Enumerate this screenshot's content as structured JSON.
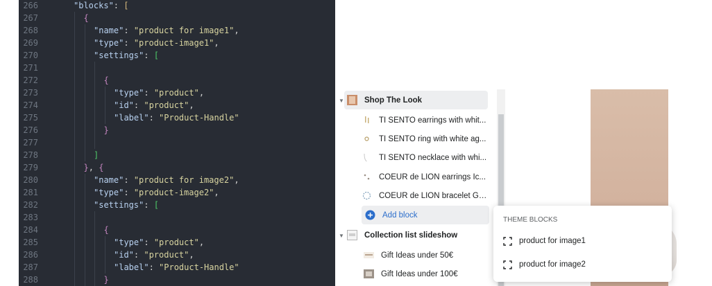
{
  "editor": {
    "lines": [
      {
        "n": "266",
        "indent": 1,
        "t": [
          [
            "key",
            "\"blocks\""
          ],
          [
            "pun",
            ": "
          ],
          [
            "p1",
            "["
          ]
        ]
      },
      {
        "n": "267",
        "indent": 2,
        "t": [
          [
            "p2",
            "{"
          ]
        ]
      },
      {
        "n": "268",
        "indent": 3,
        "t": [
          [
            "key",
            "\"name\""
          ],
          [
            "pun",
            ": "
          ],
          [
            "str",
            "\"product for image1\""
          ],
          [
            "pun",
            ","
          ]
        ]
      },
      {
        "n": "269",
        "indent": 3,
        "t": [
          [
            "key",
            "\"type\""
          ],
          [
            "pun",
            ": "
          ],
          [
            "str",
            "\"product-image1\""
          ],
          [
            "pun",
            ","
          ]
        ]
      },
      {
        "n": "270",
        "indent": 3,
        "t": [
          [
            "key",
            "\"settings\""
          ],
          [
            "pun",
            ": "
          ],
          [
            "p4",
            "["
          ]
        ]
      },
      {
        "n": "271",
        "indent": 4,
        "t": []
      },
      {
        "n": "272",
        "indent": 4,
        "t": [
          [
            "p2",
            "{"
          ]
        ]
      },
      {
        "n": "273",
        "indent": 5,
        "t": [
          [
            "key",
            "\"type\""
          ],
          [
            "pun",
            ": "
          ],
          [
            "str",
            "\"product\""
          ],
          [
            "pun",
            ","
          ]
        ]
      },
      {
        "n": "274",
        "indent": 5,
        "t": [
          [
            "key",
            "\"id\""
          ],
          [
            "pun",
            ": "
          ],
          [
            "str",
            "\"product\""
          ],
          [
            "pun",
            ","
          ]
        ]
      },
      {
        "n": "275",
        "indent": 5,
        "t": [
          [
            "key",
            "\"label\""
          ],
          [
            "pun",
            ": "
          ],
          [
            "str",
            "\"Product-Handle\""
          ]
        ]
      },
      {
        "n": "276",
        "indent": 4,
        "t": [
          [
            "p2",
            "}"
          ]
        ]
      },
      {
        "n": "277",
        "indent": 4,
        "t": []
      },
      {
        "n": "278",
        "indent": 3,
        "t": [
          [
            "p4",
            "]"
          ]
        ]
      },
      {
        "n": "279",
        "indent": 2,
        "t": [
          [
            "p2",
            "}"
          ],
          [
            "pun",
            ", "
          ],
          [
            "p2",
            "{"
          ]
        ]
      },
      {
        "n": "280",
        "indent": 3,
        "t": [
          [
            "key",
            "\"name\""
          ],
          [
            "pun",
            ": "
          ],
          [
            "str",
            "\"product for image2\""
          ],
          [
            "pun",
            ","
          ]
        ]
      },
      {
        "n": "281",
        "indent": 3,
        "t": [
          [
            "key",
            "\"type\""
          ],
          [
            "pun",
            ": "
          ],
          [
            "str",
            "\"product-image2\""
          ],
          [
            "pun",
            ","
          ]
        ]
      },
      {
        "n": "282",
        "indent": 3,
        "t": [
          [
            "key",
            "\"settings\""
          ],
          [
            "pun",
            ": "
          ],
          [
            "p4",
            "["
          ]
        ]
      },
      {
        "n": "283",
        "indent": 4,
        "t": []
      },
      {
        "n": "284",
        "indent": 4,
        "t": [
          [
            "p2",
            "{"
          ]
        ]
      },
      {
        "n": "285",
        "indent": 5,
        "t": [
          [
            "key",
            "\"type\""
          ],
          [
            "pun",
            ": "
          ],
          [
            "str",
            "\"product\""
          ],
          [
            "pun",
            ","
          ]
        ]
      },
      {
        "n": "286",
        "indent": 5,
        "t": [
          [
            "key",
            "\"id\""
          ],
          [
            "pun",
            ": "
          ],
          [
            "str",
            "\"product\""
          ],
          [
            "pun",
            ","
          ]
        ]
      },
      {
        "n": "287",
        "indent": 5,
        "t": [
          [
            "key",
            "\"label\""
          ],
          [
            "pun",
            ": "
          ],
          [
            "str",
            "\"Product-Handle\""
          ]
        ]
      },
      {
        "n": "288",
        "indent": 4,
        "t": [
          [
            "p2",
            "}"
          ]
        ]
      }
    ]
  },
  "sidebar": {
    "shop_the_look": {
      "label": "Shop The Look",
      "blocks": [
        "TI SENTO earrings with whit...",
        "TI SENTO ring with white ag...",
        "TI SENTO necklace with whi...",
        "COEUR de LION earrings Ic...",
        "COEUR de LION bracelet Ge..."
      ],
      "add_block_label": "Add block"
    },
    "collection_list": {
      "label": "Collection list slideshow",
      "blocks": [
        "Gift Ideas under 50€",
        "Gift Ideas under 100€"
      ]
    }
  },
  "popover": {
    "heading": "THEME BLOCKS",
    "items": [
      "product for image1",
      "product for image2"
    ]
  },
  "colors": {
    "accent": "#2c6ecb",
    "editor_bg": "#282c34",
    "selected_row": "#edeef0"
  }
}
